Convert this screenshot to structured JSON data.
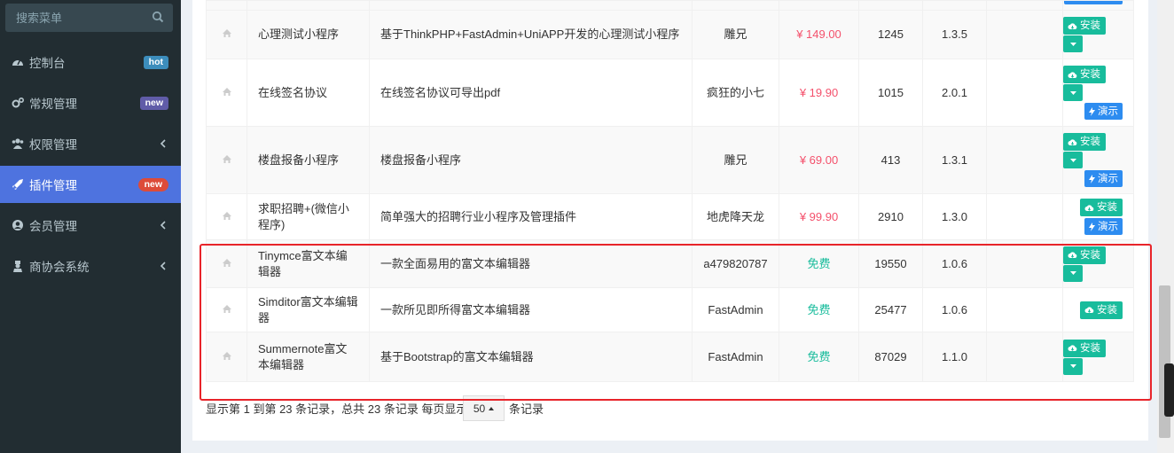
{
  "sidebar": {
    "search_placeholder": "搜索菜单",
    "items": [
      {
        "label": "控制台",
        "badge": "hot",
        "icon": "dashboard-icon"
      },
      {
        "label": "常规管理",
        "badge": "new",
        "icon": "cogs-icon"
      },
      {
        "label": "权限管理",
        "badge": "",
        "icon": "users-icon"
      },
      {
        "label": "插件管理",
        "badge": "new",
        "icon": "rocket-icon",
        "active": true
      },
      {
        "label": "会员管理",
        "badge": "",
        "icon": "user-circle-icon"
      },
      {
        "label": "商协会系统",
        "badge": "",
        "icon": "user-secret-icon"
      }
    ]
  },
  "table": {
    "rows": [
      {
        "name": "心理测试小程序",
        "intro": "基于ThinkPHP+FastAdmin+UniAPP开发的心理测试小程序",
        "author": "雕兄",
        "price": "¥ 149.00",
        "downloads": "1245",
        "version": "1.3.5"
      },
      {
        "name": "在线签名协议",
        "intro": "在线签名协议可导出pdf",
        "author": "疯狂的小七",
        "price": "¥ 19.90",
        "downloads": "1015",
        "version": "2.0.1"
      },
      {
        "name": "楼盘报备小程序",
        "intro": "楼盘报备小程序",
        "author": "雕兄",
        "price": "¥ 69.00",
        "downloads": "413",
        "version": "1.3.1"
      },
      {
        "name": "求职招聘+(微信小程序)",
        "intro": "简单强大的招聘行业小程序及管理插件",
        "author": "地虎降天龙",
        "price": "¥ 99.90",
        "downloads": "2910",
        "version": "1.3.0"
      },
      {
        "name": "Tinymce富文本编辑器",
        "intro": "一款全面易用的富文本编辑器",
        "author": "a479820787",
        "price": "免费",
        "downloads": "19550",
        "version": "1.0.6"
      },
      {
        "name": "Simditor富文本编辑器",
        "intro": "一款所见即所得富文本编辑器",
        "author": "FastAdmin",
        "price": "免费",
        "downloads": "25477",
        "version": "1.0.6"
      },
      {
        "name": "Summernote富文本编辑器",
        "intro": "基于Bootstrap的富文本编辑器",
        "author": "FastAdmin",
        "price": "免费",
        "downloads": "87029",
        "version": "1.1.0"
      }
    ],
    "install_label": "安装",
    "demo_label": "演示"
  },
  "pagination": {
    "summary": "显示第 1 到第 23 条记录，总共 23 条记录 每页显示",
    "page_size": "50",
    "suffix": "条记录"
  }
}
